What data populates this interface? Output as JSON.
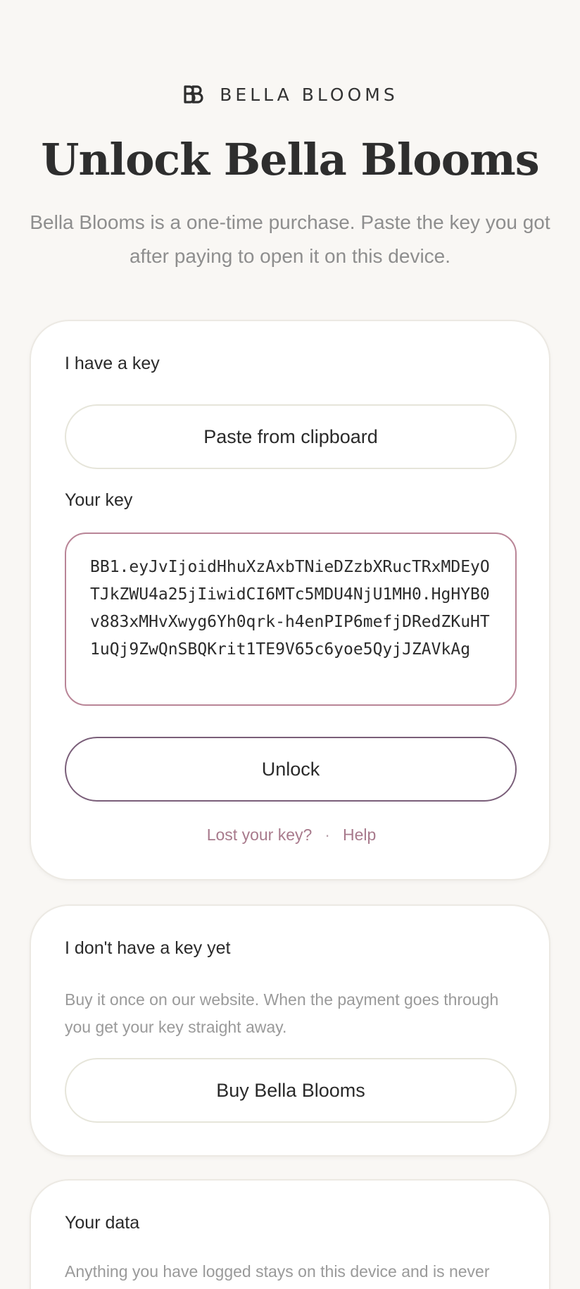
{
  "brand": {
    "name": "BELLA BLOOMS",
    "icon": "bb-monogram-icon"
  },
  "header": {
    "title": "Unlock Bella Blooms",
    "subtitle": "Bella Blooms is a one-time purchase. Paste the key you got after paying to open it on this device."
  },
  "key_card": {
    "heading": "I have a key",
    "paste_button": "Paste from clipboard",
    "key_label": "Your key",
    "key_value": "BB1.eyJvIjoidHhuXzAxbTNieDZzbXRucTRxMDEyOTJkZWU4a25jIiwidCI6MTc5MDU4NjU1MH0.HgHYB0v883xMHvXwyg6Yh0qrk-h4enPIP6mefjDRedZKuHT1uQj9ZwQnSBQKrit1TE9V65c6yoe5QyjJZAVkAg",
    "unlock_button": "Unlock",
    "lost_key_link": "Lost your key?",
    "separator": "·",
    "help_link": "Help"
  },
  "buy_card": {
    "heading": "I don't have a key yet",
    "text": "Buy it once on our website. When the payment goes through you get your key straight away.",
    "buy_button": "Buy Bella Blooms"
  },
  "data_card": {
    "heading": "Your data",
    "text": "Anything you have logged stays on this device and is never"
  },
  "colors": {
    "background": "#f9f7f4",
    "accent_border": "#b98597",
    "unlock_border": "#7a5e79",
    "link": "#a87a8c"
  }
}
